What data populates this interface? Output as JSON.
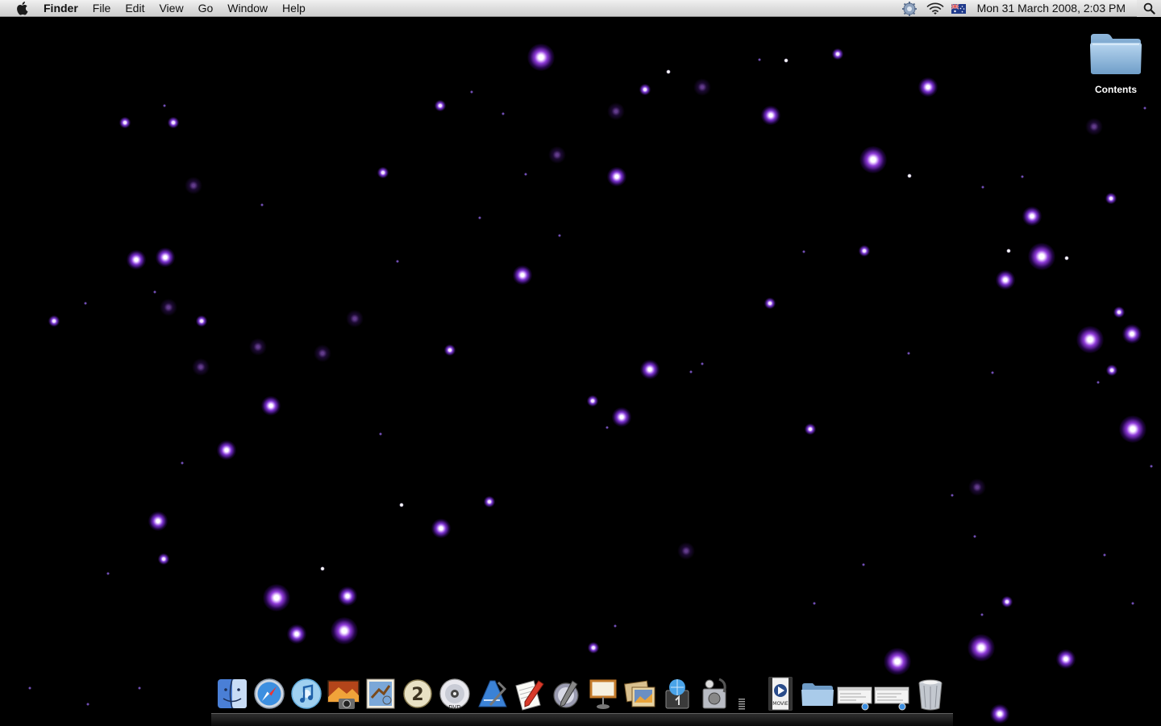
{
  "menubar": {
    "apple_icon": "apple-logo",
    "app_name": "Finder",
    "menus": [
      "File",
      "Edit",
      "View",
      "Go",
      "Window",
      "Help"
    ],
    "status_icons": [
      "sync-gear-icon",
      "wifi-icon",
      "australian-flag-icon"
    ],
    "clock": "Mon 31 March 2008,  2:03 PM",
    "spotlight_icon": "magnifier-icon"
  },
  "desktop": {
    "wallpaper": "purple starfield on black",
    "accent_color": "#a046ff",
    "folder": {
      "label": "Contents",
      "icon": "folder-icon"
    }
  },
  "dock": {
    "items": [
      {
        "icon": "finder-icon"
      },
      {
        "icon": "safari-icon"
      },
      {
        "icon": "itunes-icon"
      },
      {
        "icon": "photo-booth-icon"
      },
      {
        "icon": "mail-icon"
      },
      {
        "icon": "spaces-icon"
      },
      {
        "icon": "dvd-player-icon"
      },
      {
        "icon": "xcode-icon"
      },
      {
        "icon": "textedit-icon"
      },
      {
        "icon": "script-editor-icon"
      },
      {
        "icon": "keynote-icon"
      },
      {
        "icon": "iphoto-icon"
      },
      {
        "icon": "network-utility-icon"
      },
      {
        "icon": "disk-utility-icon"
      },
      {
        "icon": "dock-separator"
      },
      {
        "icon": "movie-file-icon"
      },
      {
        "icon": "folder-icon"
      },
      {
        "icon": "window-screenshot-icon"
      },
      {
        "icon": "window-screenshot-icon"
      },
      {
        "icon": "trash-icon"
      }
    ]
  }
}
